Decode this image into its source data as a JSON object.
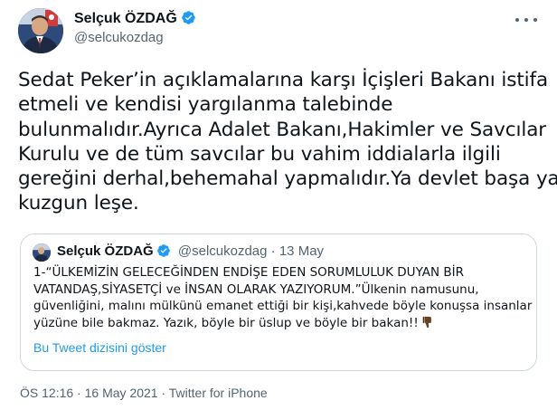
{
  "author": {
    "name": "Selçuk ÖZDAĞ",
    "handle": "@selcukozdag",
    "verified": true
  },
  "tweet": {
    "lines": [
      "Sedat Peker’in açıklamalarına karşı İçişleri Bakanı istifa",
      "etmeli ve kendisi yargılanma talebinde",
      "bulunmalıdır.Ayrıca Adalet Bakanı,Hakimler ve Savcılar",
      "Kurulu ve de tüm savcılar bu vahim iddialarla ilgili",
      "gereğini derhal,behemahal yapmalıdır.Ya devlet başa ya",
      "kuzgun leşe."
    ]
  },
  "quote": {
    "name": "Selçuk ÖZDAĞ",
    "handle": "@selcukozdag",
    "dot": "·",
    "date": "13 May",
    "lines": [
      "1-“ÜLKEMİZİN GELECEĞİNDEN ENDİŞE EDEN SORUMLULUK DUYAN BİR",
      "VATANDAŞ,SİYASETÇİ ve İNSAN OLARAK YAZIYORUM.”Ülkenin namusunu,",
      "güvenliğini, malını mülkünü emanet ettiği bir kişi,kahvede böyle konuşsa insanlar",
      "yüzüne bile bakmaz. Yazık, böyle bir üslup ve böyle bir bakan!!"
    ],
    "thread_link": "Bu Tweet dizisini göster"
  },
  "meta": {
    "time": "ÖS 12:16",
    "sep1": "·",
    "date": "16 May 2021",
    "sep2": "·",
    "source": "Twitter for iPhone"
  },
  "colors": {
    "verified": "#1d9bf0",
    "link": "#1d9bf0",
    "secondary_text": "#536471",
    "border": "#cfd9de"
  },
  "icons": [
    "verified-badge-icon",
    "more-options-icon",
    "thumbs-down-emoji-icon"
  ]
}
